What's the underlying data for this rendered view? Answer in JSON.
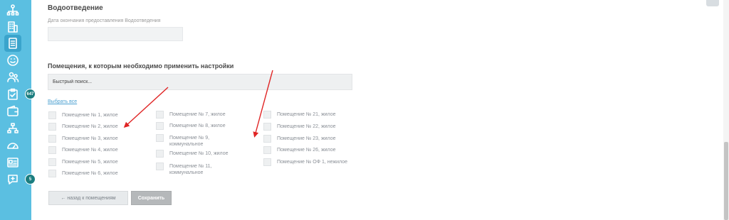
{
  "sidebar": {
    "items": [
      {
        "icon": "hierarchy-icon"
      },
      {
        "icon": "building-icon"
      },
      {
        "icon": "document-icon",
        "active": true
      },
      {
        "icon": "smile-icon"
      },
      {
        "icon": "people-icon"
      },
      {
        "icon": "clipboard-icon",
        "badge": "647"
      },
      {
        "icon": "wallet-icon"
      },
      {
        "icon": "network-icon"
      },
      {
        "icon": "dashboard-icon"
      },
      {
        "icon": "id-card-icon"
      },
      {
        "icon": "chat-icon",
        "badge": "5"
      }
    ]
  },
  "form": {
    "section_title": "Водоотведение",
    "date_label": "Дата окончания предоставления Водоотведения",
    "date_value": ""
  },
  "rooms": {
    "title": "Помещения, к которым необходимо применить настройки",
    "search_placeholder": "Быстрый поиск...",
    "select_all": "Выбрать все",
    "col1": [
      "Помещение № 1, жилое",
      "Помещение № 2, жилое",
      "Помещение № 3, жилое",
      "Помещение № 4, жилое",
      "Помещение № 5, жилое",
      "Помещение № 6, жилое"
    ],
    "col2": [
      "Помещение № 7, жилое",
      "Помещение № 8, жилое",
      "Помещение № 9, коммунальное",
      "Помещение № 10, жилое",
      "Помещение № 11, коммунальное"
    ],
    "col3": [
      "Помещение № 21, жилое",
      "Помещение № 22, жилое",
      "Помещение № 23, жилое",
      "Помещение № 26, жилое",
      "Помещение № ОФ 1, нежилое"
    ]
  },
  "actions": {
    "back_label": "← назад к помещениям",
    "save_label": "Сохранить"
  },
  "colors": {
    "sidebar": "#5bbfe1",
    "badge": "#1a7d7f",
    "annotation_arrow": "#e02424"
  }
}
